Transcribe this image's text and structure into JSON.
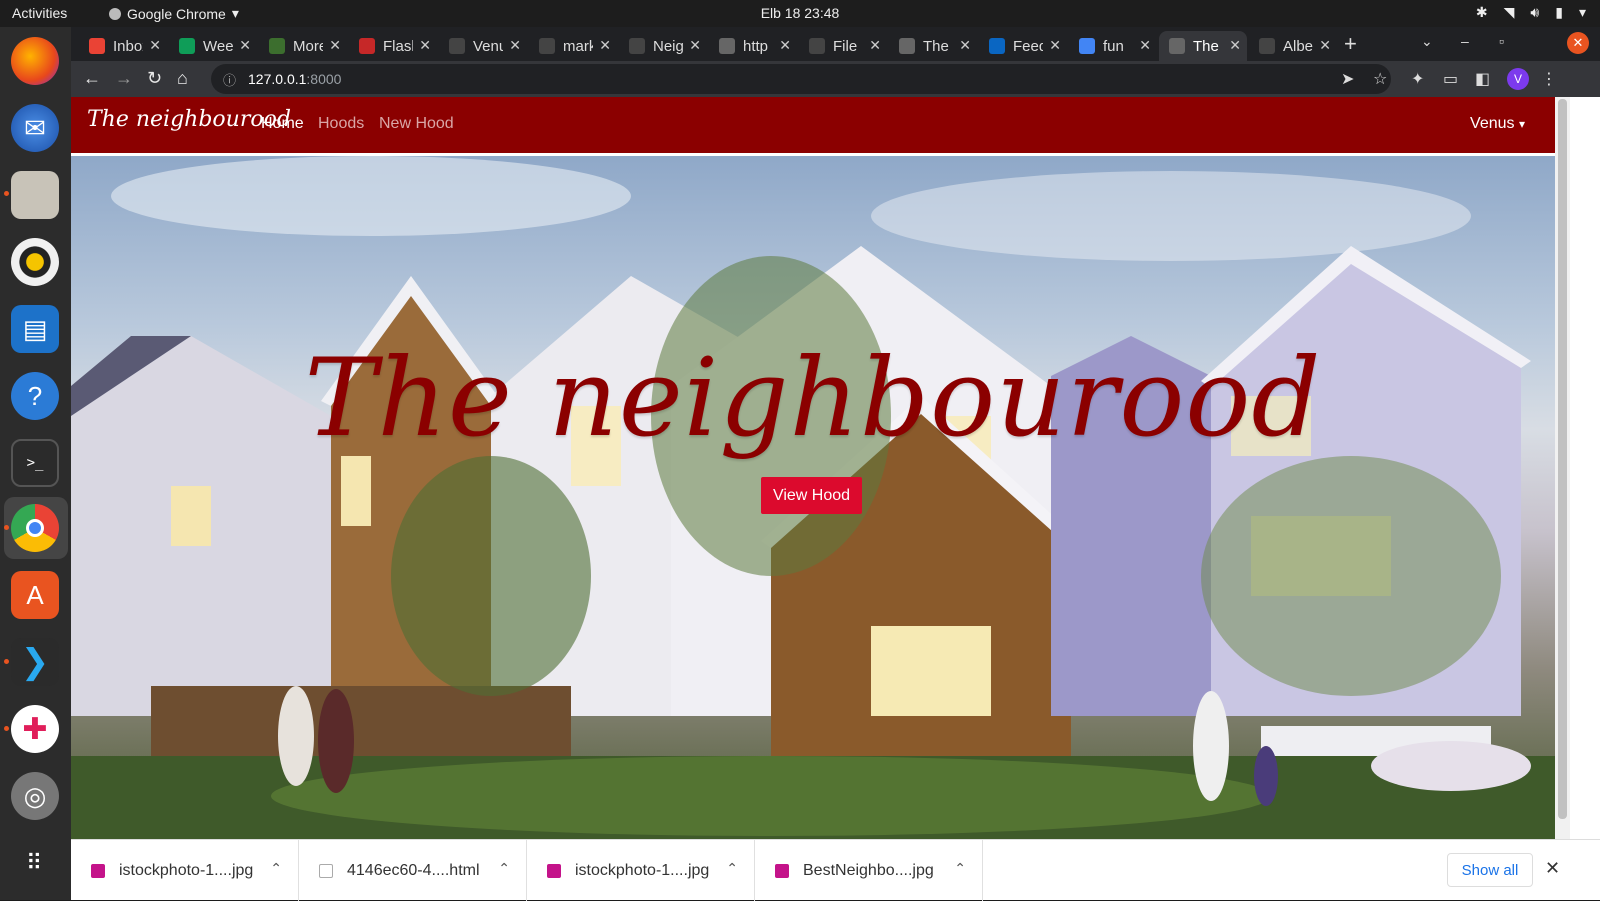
{
  "topbar": {
    "activities": "Activities",
    "app_name": "Google Chrome",
    "clock": "Elb 18  23:48"
  },
  "tabs": [
    {
      "title": "Inbox",
      "favicon": "gmail-icon",
      "color": "#ea4335"
    },
    {
      "title": "Week",
      "favicon": "sheets-icon",
      "color": "#0f9d58"
    },
    {
      "title": "More",
      "favicon": "leaf-icon",
      "color": "#3c6e2e"
    },
    {
      "title": "Flask",
      "favicon": "flask-icon",
      "color": "#c62828"
    },
    {
      "title": "Venus",
      "favicon": "github-icon",
      "color": "#444444"
    },
    {
      "title": "mark",
      "favicon": "github-icon",
      "color": "#444444"
    },
    {
      "title": "Neighbourhood",
      "favicon": "github-icon",
      "color": "#444444"
    },
    {
      "title": "http",
      "favicon": "globe-icon",
      "color": "#666666"
    },
    {
      "title": "File",
      "favicon": "github-icon",
      "color": "#444444"
    },
    {
      "title": "The",
      "favicon": "globe-icon",
      "color": "#666666"
    },
    {
      "title": "Feed",
      "favicon": "linkedin-icon",
      "color": "#0a66c2"
    },
    {
      "title": "fun",
      "favicon": "google-icon",
      "color": "#4285f4"
    },
    {
      "title": "The",
      "favicon": "globe-icon",
      "color": "#666666",
      "active": true
    },
    {
      "title": "Albert",
      "favicon": "github-icon",
      "color": "#444444"
    }
  ],
  "address": {
    "host": "127.0.0.1",
    "port": ":8000"
  },
  "site": {
    "brand": "The neighbourood",
    "nav": [
      "Home",
      "Hoods",
      "New Hood"
    ],
    "user": "Venus",
    "hero_title": "The neighbourood",
    "hero_button": "View Hood",
    "accent": "#8b0000",
    "button_color": "#dc0a2d"
  },
  "downloads": [
    {
      "name": "istockphoto-1....jpg",
      "type": "image"
    },
    {
      "name": "4146ec60-4....html",
      "type": "html"
    },
    {
      "name": "istockphoto-1....jpg",
      "type": "image"
    },
    {
      "name": "BestNeighbo....jpg",
      "type": "image"
    }
  ],
  "shelf": {
    "show_all": "Show all"
  },
  "profile_initial": "V"
}
